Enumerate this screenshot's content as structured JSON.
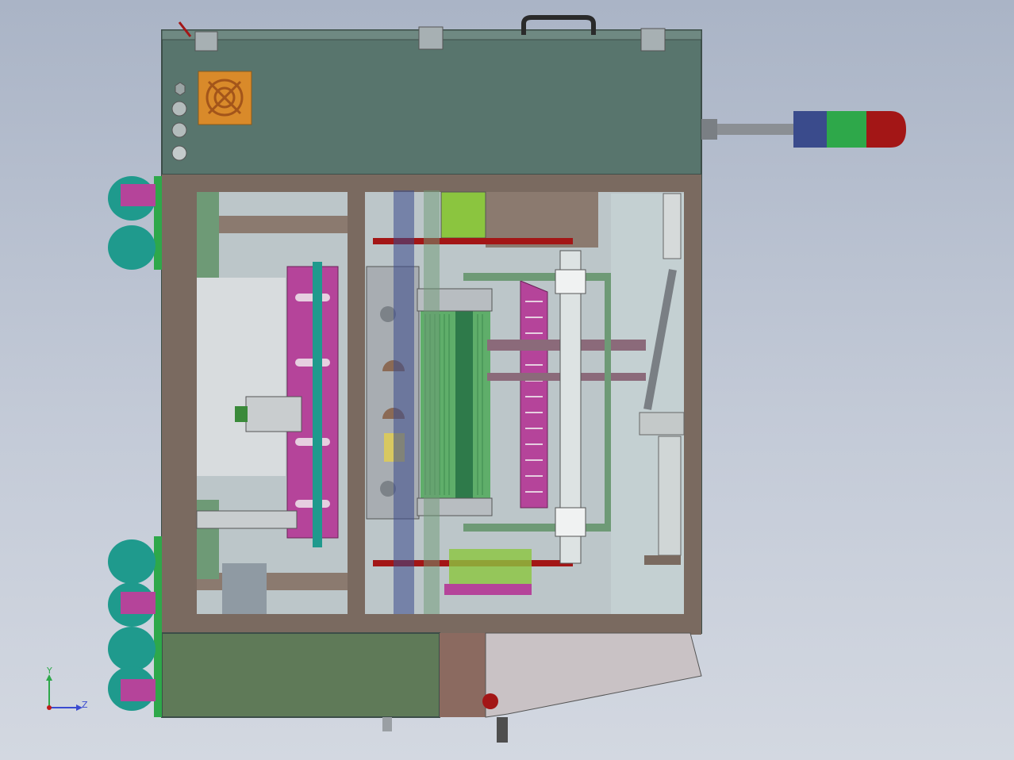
{
  "viewport": {
    "background_top": "#aab4c6",
    "background_bottom": "#d3d8e1"
  },
  "model": {
    "housing_color": "#58756d",
    "frame_color": "#7a6a60",
    "base_color": "#5f7a58",
    "accent_magenta": "#b5449a",
    "accent_teal": "#1f9a8d",
    "accent_red": "#a31616",
    "accent_green": "#2ea84a",
    "accent_blue": "#3a4b8c",
    "fan_color": "#d98a2a"
  },
  "signal_tower": {
    "segments": [
      "blue",
      "green",
      "red"
    ]
  },
  "triad": {
    "y_label": "Y",
    "z_label": "Z"
  }
}
